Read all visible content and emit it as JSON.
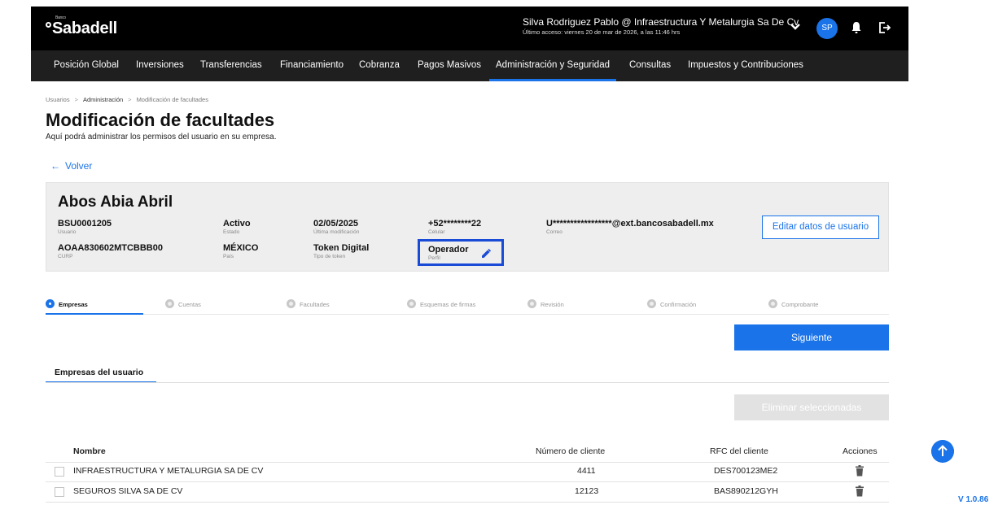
{
  "header": {
    "logo_small": "Banco",
    "logo": "Sabadell",
    "user_name": "Silva Rodriguez Pablo @ Infraestructura Y Metalurgia Sa De Cv",
    "last_access": "Último acceso: viernes 20 de mar de 2026, a las 11:46 hrs",
    "avatar_initials": "SP",
    "accent_color": "#1a73e8"
  },
  "nav": {
    "items": [
      {
        "label": "Posición Global"
      },
      {
        "label": "Inversiones"
      },
      {
        "label": "Transferencias"
      },
      {
        "label": "Financiamiento"
      },
      {
        "label": "Cobranza"
      },
      {
        "label": "Pagos Masivos"
      },
      {
        "label": "Administración y Seguridad",
        "active": true
      },
      {
        "label": "Consultas"
      },
      {
        "label": "Impuestos y Contribuciones"
      }
    ]
  },
  "breadcrumb": {
    "items": [
      "Usuarios",
      "Administración",
      "Modificación de facultades"
    ],
    "sep": ">"
  },
  "page": {
    "title": "Modificación de facultades",
    "subtitle": "Aquí podrá administrar los permisos del usuario en su empresa.",
    "back_arrow": "←",
    "back_label": "Volver"
  },
  "user": {
    "name": "Abos Abia Abril",
    "usuario": {
      "value": "BSU0001205",
      "label": "Usuario"
    },
    "estado": {
      "value": "Activo",
      "label": "Estado"
    },
    "ultima_mod": {
      "value": "02/05/2025",
      "label": "Última modificación"
    },
    "celular": {
      "value": "+52********22",
      "label": "Celular"
    },
    "correo": {
      "value": "U*****************@ext.bancosabadell.mx",
      "label": "Correo"
    },
    "curp": {
      "value": "AOAA830602MTCBBB00",
      "label": "CURP"
    },
    "pais": {
      "value": "MÉXICO",
      "label": "País"
    },
    "token": {
      "value": "Token Digital",
      "label": "Tipo de token"
    },
    "perfil": {
      "value": "Operador",
      "label": "Perfil"
    },
    "edit_button": "Editar datos de usuario"
  },
  "steps": [
    {
      "label": "Empresas",
      "active": true
    },
    {
      "label": "Cuentas"
    },
    {
      "label": "Facultades"
    },
    {
      "label": "Esquemas de firmas"
    },
    {
      "label": "Revisión"
    },
    {
      "label": "Confirmación"
    },
    {
      "label": "Comprobante"
    }
  ],
  "buttons": {
    "next": "Siguiente",
    "delete_selected": "Eliminar seleccionadas"
  },
  "tab": {
    "label": "Empresas del usuario"
  },
  "table": {
    "columns": {
      "name": "Nombre",
      "client_number": "Número de cliente",
      "rfc": "RFC del cliente",
      "actions": "Acciones"
    },
    "rows": [
      {
        "name": "INFRAESTRUCTURA Y METALURGIA SA DE CV",
        "client_number": "4411",
        "rfc": "DES700123ME2"
      },
      {
        "name": "SEGUROS SILVA SA DE CV",
        "client_number": "12123",
        "rfc": "BAS890212GYH"
      }
    ]
  },
  "version": "V 1.0.86"
}
